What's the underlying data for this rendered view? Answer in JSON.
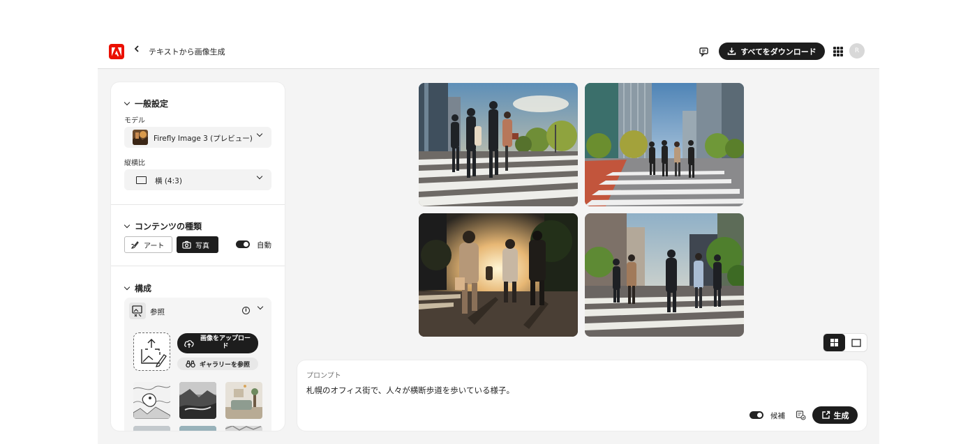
{
  "header": {
    "title": "テキストから画像生成",
    "download_all_label": "すべてをダウンロード",
    "avatar_initial": "R",
    "brand_color": "#eb1000"
  },
  "sidebar": {
    "general": {
      "heading": "一般設定",
      "model_label": "モデル",
      "model_value": "Firefly Image 3 (プレビュー)",
      "aspect_label": "縦横比",
      "aspect_value": "横 (4:3)"
    },
    "content_type": {
      "heading": "コンテンツの種類",
      "art_label": "アート",
      "photo_label": "写真",
      "auto_label": "自動",
      "auto_enabled": true,
      "selected": "写真"
    },
    "composition": {
      "heading": "構成",
      "reference_label": "参照",
      "upload_label": "画像をアップロード",
      "gallery_label": "ギャラリーを参照"
    }
  },
  "results": {
    "images": [
      "crosswalk-pedestrians-1",
      "crosswalk-pedestrians-2",
      "crosswalk-pedestrians-3",
      "crosswalk-pedestrians-4"
    ]
  },
  "prompt": {
    "label": "プロンプト",
    "text": "札幌のオフィス街で、人々が横断歩道を歩いている様子。",
    "candidates_label": "候補",
    "candidates_enabled": true,
    "generate_label": "生成"
  }
}
